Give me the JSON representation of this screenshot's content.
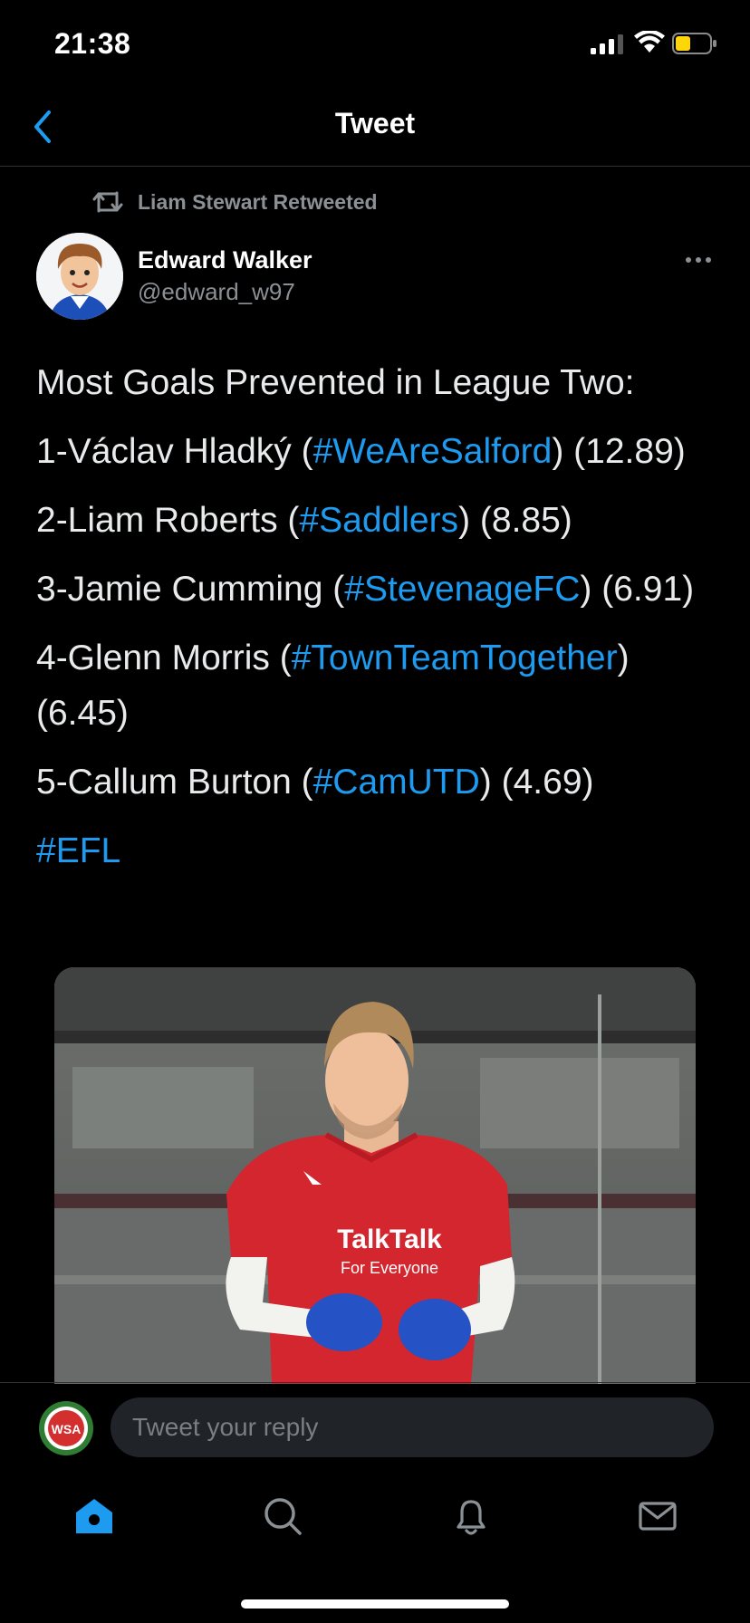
{
  "status_bar": {
    "time": "21:38"
  },
  "nav": {
    "title": "Tweet"
  },
  "retweet": {
    "label": "Liam Stewart Retweeted"
  },
  "author": {
    "name": "Edward Walker",
    "handle": "@edward_w97"
  },
  "tweet": {
    "heading": "Most Goals Prevented in League Two:",
    "lines": [
      {
        "prefix": "1-Václav Hladký (",
        "tag": "#WeAreSalford",
        "suffix": ") (12.89)"
      },
      {
        "prefix": "2-Liam Roberts (",
        "tag": "#Saddlers",
        "suffix": ") (8.85)"
      },
      {
        "prefix": "3-Jamie Cumming (",
        "tag": "#StevenageFC",
        "suffix": ") (6.91)"
      },
      {
        "prefix": "4-Glenn Morris (",
        "tag": "#TownTeamTogether",
        "suffix": ") (6.45)"
      },
      {
        "prefix": "5-Callum Burton (",
        "tag": "#CamUTD",
        "suffix": ") (4.69)"
      }
    ],
    "footer_tag": "#EFL"
  },
  "media": {
    "shirt_sponsor": "TalkTalk",
    "shirt_sponsor_sub": "For Everyone"
  },
  "reply": {
    "placeholder": "Tweet your reply",
    "avatar_text": "WSA"
  },
  "tabs": [
    {
      "icon": "home-icon",
      "active": true
    },
    {
      "icon": "search-icon",
      "active": false
    },
    {
      "icon": "bell-icon",
      "active": false
    },
    {
      "icon": "mail-icon",
      "active": false
    }
  ],
  "colors": {
    "accent": "#1d9bf0",
    "background": "#000000",
    "muted": "#8b9095"
  }
}
